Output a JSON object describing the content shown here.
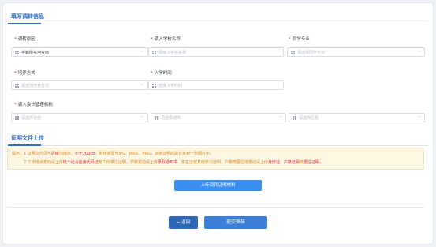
{
  "section1": {
    "title": "填写调转信息"
  },
  "fields": {
    "reason": {
      "label": "调转原因",
      "value": "学籍所在地变动"
    },
    "school": {
      "label": "调入学校名称",
      "placeholder": "请输入学校名称"
    },
    "major": {
      "label": "同学专业",
      "placeholder": "请选择同学专业"
    },
    "mode": {
      "label": "培养方式",
      "placeholder": "请选择培养方式"
    },
    "time": {
      "label": "入学时间",
      "placeholder": "选择入学时间"
    },
    "agency": {
      "label": "调入会计管理机构"
    },
    "province": {
      "placeholder": "请选择省份"
    },
    "city": {
      "placeholder": "请选择城市"
    },
    "district": {
      "placeholder": "请选择区县"
    }
  },
  "section2": {
    "title": "证明文件上传"
  },
  "notice": {
    "prefix": "提示：",
    "line1": {
      "a": "1.证明文件须为",
      "b": "清晰",
      "c": "扫描件，",
      "d": "小于200kb",
      "e": "，附件类型为JPG、JPEG、PNG，多张证明的需合并到一张图片中。"
    },
    "line2": {
      "a": "2.工作地点变动请上传",
      "b": "统一社会信用代码证",
      "c": "或工作单位证明",
      "d": "，学籍变动请上传",
      "e": "录取通知书",
      "f": "、学生证或其他学习证明，户籍或居住地变动请上传",
      "g": "身份证",
      "h": "、",
      "i": "户籍证明",
      "j": "或",
      "k": "居住证明",
      "l": "。"
    }
  },
  "buttons": {
    "upload": "上传调转证明材料",
    "back": "← 返回",
    "submit": "提交审核"
  },
  "colors": {
    "accent": "#2d6fd1",
    "required": "#e0303a",
    "notice_text": "#d98a1c"
  },
  "icons": {
    "field_icon": "grid-icon",
    "dropdown_icon": "chevron-down-icon"
  }
}
